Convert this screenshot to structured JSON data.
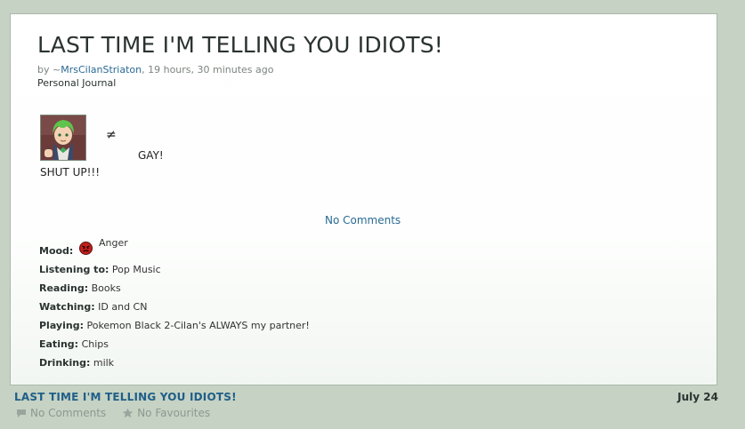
{
  "post": {
    "title": "LAST TIME I'M TELLING YOU IDIOTS!",
    "by_prefix": "by ~",
    "author": "MrsCilanStriaton",
    "time_ago": ", 19 hours, 30 minutes ago",
    "category": "Personal Journal",
    "body": {
      "avatar_icon": "cilan-avatar-icon",
      "not_equal": "≠",
      "gay_text": "GAY!",
      "shut_up_text": "SHUT UP!!!"
    },
    "comments_link": "No Comments"
  },
  "meta": {
    "mood_label": "Mood:",
    "mood_value": "Anger",
    "mood_icon": "anger-face-icon",
    "items": [
      {
        "label": "Listening to:",
        "value": "Pop Music"
      },
      {
        "label": "Reading:",
        "value": "Books"
      },
      {
        "label": "Watching:",
        "value": "ID and CN"
      },
      {
        "label": "Playing:",
        "value": "Pokemon Black 2-Cilan's ALWAYS my partner!"
      },
      {
        "label": "Eating:",
        "value": "Chips"
      },
      {
        "label": "Drinking:",
        "value": "milk"
      }
    ]
  },
  "footer": {
    "title": "LAST TIME I'M TELLING YOU IDIOTS!",
    "date": "July 24",
    "comments": "No Comments",
    "favourites": "No Favourites"
  },
  "colors": {
    "page_bg": "#c6d2c4",
    "link": "#2a6a95",
    "footer_link": "#1f5f88"
  }
}
